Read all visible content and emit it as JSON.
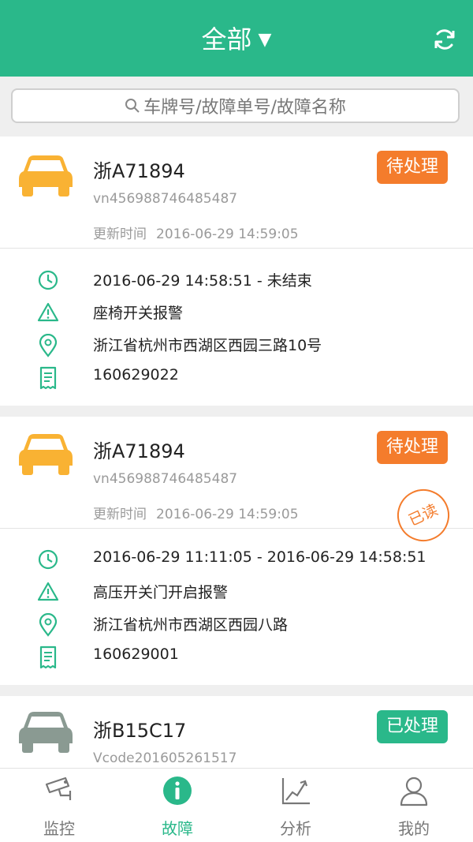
{
  "header": {
    "title": "全部",
    "caret": "▼",
    "refresh_icon": "refresh-icon"
  },
  "search": {
    "placeholder": "车牌号/故障单号/故障名称"
  },
  "labels": {
    "update_time": "更新时间"
  },
  "colors": {
    "brand": "#2ab88a",
    "pending": "#f47c2c",
    "car_active": "#f9b233",
    "car_inactive": "#8a9a92"
  },
  "faults": [
    {
      "plate": "浙A71894",
      "vin": "vn456988746485487",
      "updated": "2016-06-29 14:59:05",
      "status": "待处理",
      "time_range": "2016-06-29 14:58:51 - 未结束",
      "alarm": "座椅开关报警",
      "location": "浙江省杭州市西湖区西园三路10号",
      "order_no": "160629022"
    },
    {
      "plate": "浙A71894",
      "vin": "vn456988746485487",
      "updated": "2016-06-29 14:59:05",
      "status": "待处理",
      "read_stamp": "已读",
      "time_range": "2016-06-29 11:11:05 - 2016-06-29 14:58:51",
      "alarm": "高压开关门开启报警",
      "location": "浙江省杭州市西湖区西园八路",
      "order_no": "160629001"
    },
    {
      "plate": "浙B15C17",
      "vin": "Vcode201605261517",
      "status": "已处理"
    }
  ],
  "nav": [
    {
      "label": "监控",
      "icon": "camera-icon"
    },
    {
      "label": "故障",
      "icon": "info-icon",
      "active": true
    },
    {
      "label": "分析",
      "icon": "chart-icon"
    },
    {
      "label": "我的",
      "icon": "user-icon"
    }
  ]
}
